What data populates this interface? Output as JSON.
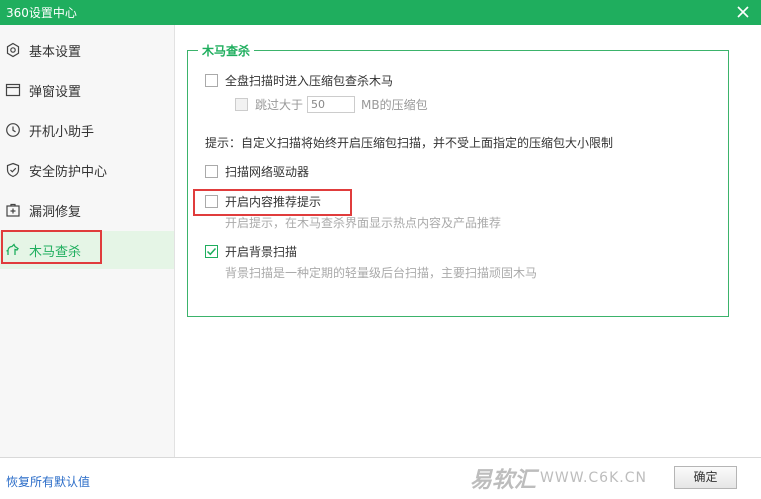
{
  "window": {
    "title": "360设置中心",
    "close_icon": "close-icon"
  },
  "sidebar": {
    "items": [
      {
        "label": "基本设置",
        "icon": "hexagon-gear-icon"
      },
      {
        "label": "弹窗设置",
        "icon": "window-icon"
      },
      {
        "label": "开机小助手",
        "icon": "clock-icon"
      },
      {
        "label": "安全防护中心",
        "icon": "shield-check-icon"
      },
      {
        "label": "漏洞修复",
        "icon": "medical-plus-icon"
      },
      {
        "label": "木马查杀",
        "icon": "horse-icon",
        "active": true
      }
    ]
  },
  "group": {
    "title": "木马查杀",
    "options": {
      "full_scan": {
        "label": "全盘扫描时进入压缩包查杀木马",
        "checked": false
      },
      "skip": {
        "prefix": "跳过大于",
        "value": "50",
        "suffix": "MB的压缩包",
        "checked": false,
        "disabled": true
      },
      "tip": "提示：自定义扫描将始终开启压缩包扫描，并不受上面指定的压缩包大小限制",
      "network_drive": {
        "label": "扫描网络驱动器",
        "checked": false
      },
      "recommend": {
        "label": "开启内容推荐提示",
        "desc": "开启提示，在木马查杀界面显示热点内容及产品推荐",
        "checked": false
      },
      "background": {
        "label": "开启背景扫描",
        "desc": "背景扫描是一种定期的轻量级后台扫描，主要扫描顽固木马",
        "checked": true
      }
    }
  },
  "footer": {
    "reset_label": "恢复所有默认值",
    "ok_label": "确定",
    "watermark": {
      "brand": "易软汇",
      "url": "WWW.C6K.CN"
    }
  },
  "colors": {
    "accent": "#1fae5e",
    "highlight": "#e03c3c",
    "link": "#2a6cc8"
  }
}
